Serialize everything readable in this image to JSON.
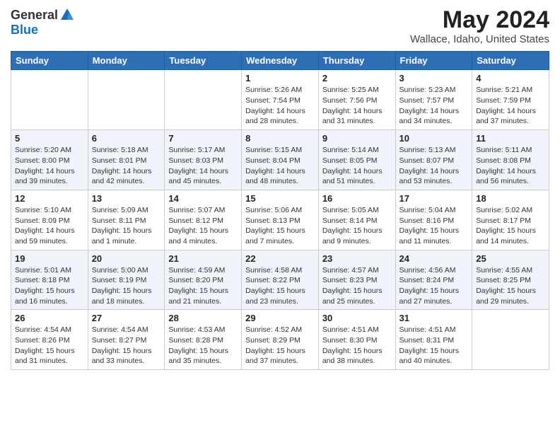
{
  "header": {
    "logo": {
      "general": "General",
      "blue": "Blue"
    },
    "title": "May 2024",
    "location": "Wallace, Idaho, United States"
  },
  "calendar": {
    "days_of_week": [
      "Sunday",
      "Monday",
      "Tuesday",
      "Wednesday",
      "Thursday",
      "Friday",
      "Saturday"
    ],
    "weeks": [
      [
        {
          "day": "",
          "info": ""
        },
        {
          "day": "",
          "info": ""
        },
        {
          "day": "",
          "info": ""
        },
        {
          "day": "1",
          "info": "Sunrise: 5:26 AM\nSunset: 7:54 PM\nDaylight: 14 hours\nand 28 minutes."
        },
        {
          "day": "2",
          "info": "Sunrise: 5:25 AM\nSunset: 7:56 PM\nDaylight: 14 hours\nand 31 minutes."
        },
        {
          "day": "3",
          "info": "Sunrise: 5:23 AM\nSunset: 7:57 PM\nDaylight: 14 hours\nand 34 minutes."
        },
        {
          "day": "4",
          "info": "Sunrise: 5:21 AM\nSunset: 7:59 PM\nDaylight: 14 hours\nand 37 minutes."
        }
      ],
      [
        {
          "day": "5",
          "info": "Sunrise: 5:20 AM\nSunset: 8:00 PM\nDaylight: 14 hours\nand 39 minutes."
        },
        {
          "day": "6",
          "info": "Sunrise: 5:18 AM\nSunset: 8:01 PM\nDaylight: 14 hours\nand 42 minutes."
        },
        {
          "day": "7",
          "info": "Sunrise: 5:17 AM\nSunset: 8:03 PM\nDaylight: 14 hours\nand 45 minutes."
        },
        {
          "day": "8",
          "info": "Sunrise: 5:15 AM\nSunset: 8:04 PM\nDaylight: 14 hours\nand 48 minutes."
        },
        {
          "day": "9",
          "info": "Sunrise: 5:14 AM\nSunset: 8:05 PM\nDaylight: 14 hours\nand 51 minutes."
        },
        {
          "day": "10",
          "info": "Sunrise: 5:13 AM\nSunset: 8:07 PM\nDaylight: 14 hours\nand 53 minutes."
        },
        {
          "day": "11",
          "info": "Sunrise: 5:11 AM\nSunset: 8:08 PM\nDaylight: 14 hours\nand 56 minutes."
        }
      ],
      [
        {
          "day": "12",
          "info": "Sunrise: 5:10 AM\nSunset: 8:09 PM\nDaylight: 14 hours\nand 59 minutes."
        },
        {
          "day": "13",
          "info": "Sunrise: 5:09 AM\nSunset: 8:11 PM\nDaylight: 15 hours\nand 1 minute."
        },
        {
          "day": "14",
          "info": "Sunrise: 5:07 AM\nSunset: 8:12 PM\nDaylight: 15 hours\nand 4 minutes."
        },
        {
          "day": "15",
          "info": "Sunrise: 5:06 AM\nSunset: 8:13 PM\nDaylight: 15 hours\nand 7 minutes."
        },
        {
          "day": "16",
          "info": "Sunrise: 5:05 AM\nSunset: 8:14 PM\nDaylight: 15 hours\nand 9 minutes."
        },
        {
          "day": "17",
          "info": "Sunrise: 5:04 AM\nSunset: 8:16 PM\nDaylight: 15 hours\nand 11 minutes."
        },
        {
          "day": "18",
          "info": "Sunrise: 5:02 AM\nSunset: 8:17 PM\nDaylight: 15 hours\nand 14 minutes."
        }
      ],
      [
        {
          "day": "19",
          "info": "Sunrise: 5:01 AM\nSunset: 8:18 PM\nDaylight: 15 hours\nand 16 minutes."
        },
        {
          "day": "20",
          "info": "Sunrise: 5:00 AM\nSunset: 8:19 PM\nDaylight: 15 hours\nand 18 minutes."
        },
        {
          "day": "21",
          "info": "Sunrise: 4:59 AM\nSunset: 8:20 PM\nDaylight: 15 hours\nand 21 minutes."
        },
        {
          "day": "22",
          "info": "Sunrise: 4:58 AM\nSunset: 8:22 PM\nDaylight: 15 hours\nand 23 minutes."
        },
        {
          "day": "23",
          "info": "Sunrise: 4:57 AM\nSunset: 8:23 PM\nDaylight: 15 hours\nand 25 minutes."
        },
        {
          "day": "24",
          "info": "Sunrise: 4:56 AM\nSunset: 8:24 PM\nDaylight: 15 hours\nand 27 minutes."
        },
        {
          "day": "25",
          "info": "Sunrise: 4:55 AM\nSunset: 8:25 PM\nDaylight: 15 hours\nand 29 minutes."
        }
      ],
      [
        {
          "day": "26",
          "info": "Sunrise: 4:54 AM\nSunset: 8:26 PM\nDaylight: 15 hours\nand 31 minutes."
        },
        {
          "day": "27",
          "info": "Sunrise: 4:54 AM\nSunset: 8:27 PM\nDaylight: 15 hours\nand 33 minutes."
        },
        {
          "day": "28",
          "info": "Sunrise: 4:53 AM\nSunset: 8:28 PM\nDaylight: 15 hours\nand 35 minutes."
        },
        {
          "day": "29",
          "info": "Sunrise: 4:52 AM\nSunset: 8:29 PM\nDaylight: 15 hours\nand 37 minutes."
        },
        {
          "day": "30",
          "info": "Sunrise: 4:51 AM\nSunset: 8:30 PM\nDaylight: 15 hours\nand 38 minutes."
        },
        {
          "day": "31",
          "info": "Sunrise: 4:51 AM\nSunset: 8:31 PM\nDaylight: 15 hours\nand 40 minutes."
        },
        {
          "day": "",
          "info": ""
        }
      ]
    ]
  }
}
